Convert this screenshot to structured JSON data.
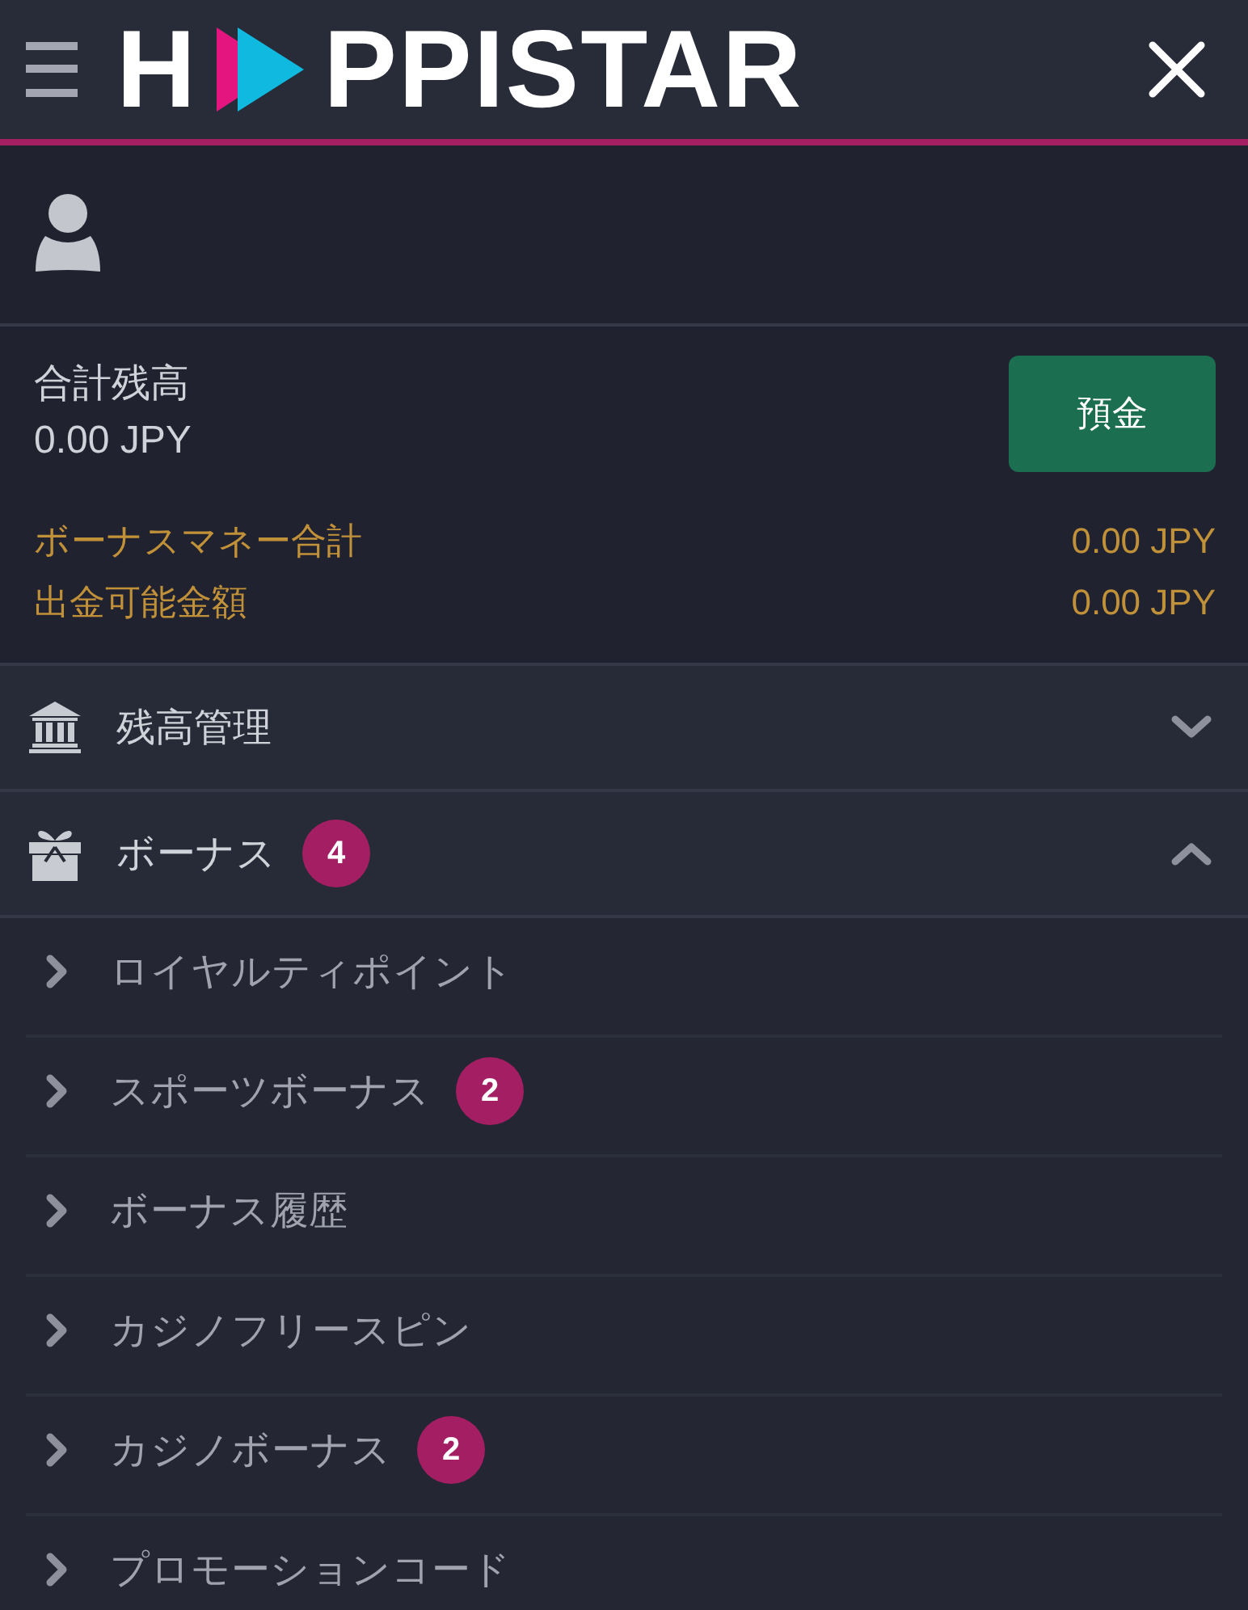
{
  "header": {
    "logo": [
      "H",
      "PPISTAR"
    ]
  },
  "account": {
    "balance_label": "合計残高",
    "balance": "0.00 JPY",
    "deposit_button": "預金",
    "summary": [
      {
        "label": "ボーナスマネー合計",
        "value": "0.00 JPY"
      },
      {
        "label": "出金可能金額",
        "value": "0.00 JPY"
      }
    ]
  },
  "menu": [
    {
      "label": "残高管理",
      "expanded": false
    },
    {
      "label": "ボーナス",
      "badge": "4",
      "expanded": true,
      "children": [
        {
          "label": "ロイヤルティポイント"
        },
        {
          "label": "スポーツボーナス",
          "badge": "2"
        },
        {
          "label": "ボーナス履歴"
        },
        {
          "label": "カジノフリースピン"
        },
        {
          "label": "カジノボーナス",
          "badge": "2"
        },
        {
          "label": "プロモーションコード"
        }
      ]
    }
  ]
}
